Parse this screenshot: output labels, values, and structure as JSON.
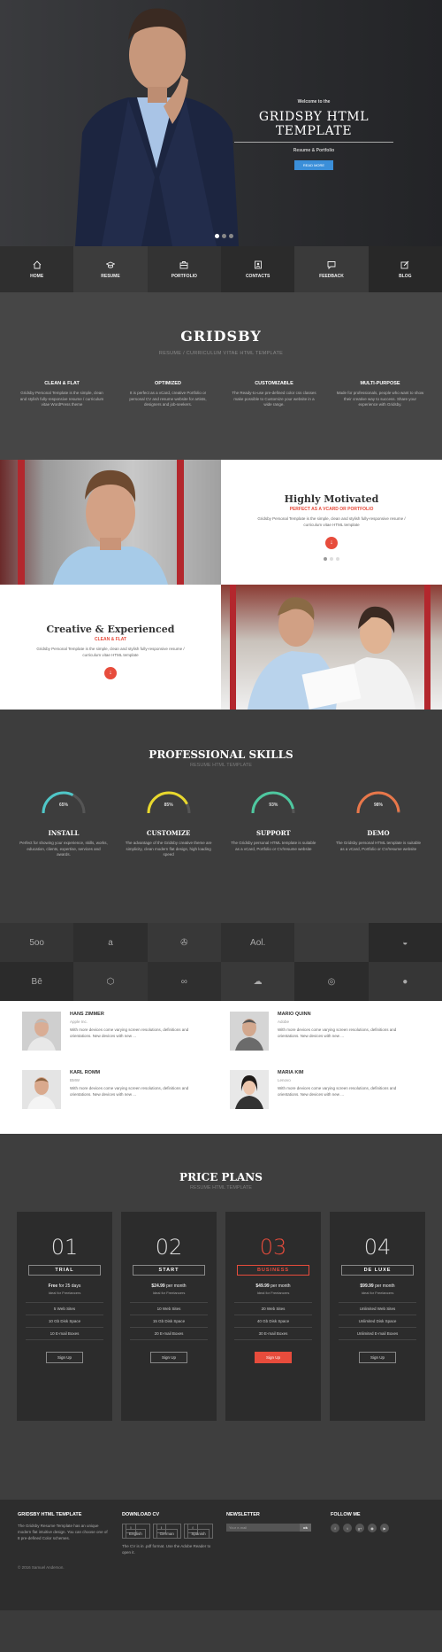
{
  "hero": {
    "welcome": "Welcome to the",
    "title": "GRIDSBY HTML TEMPLATE",
    "subtitle": "Resume & Portfolio",
    "button": "READ MORE"
  },
  "nav": [
    {
      "label": "HOME",
      "icon": "home-icon"
    },
    {
      "label": "RESUME",
      "icon": "graduation-cap-icon"
    },
    {
      "label": "PORTFOLIO",
      "icon": "briefcase-icon"
    },
    {
      "label": "CONTACTS",
      "icon": "address-card-icon"
    },
    {
      "label": "FEEDBACK",
      "icon": "chat-bubble-icon"
    },
    {
      "label": "BLOG",
      "icon": "edit-icon"
    }
  ],
  "intro": {
    "title": "GRIDSBY",
    "tagline": "RESUME / CURRICULUM VITAE HTML TEMPLATE",
    "features": [
      {
        "title": "CLEAN & FLAT",
        "text": "Gridsby Personal Template is the simple, clean and stylish fully-responsive resume / curriculum vitae WordPress theme"
      },
      {
        "title": "OPTIMIZED",
        "text": "It is perfect as a vCard, creative Portfolio or personal CV and resume website for artists, designers and job-seekers."
      },
      {
        "title": "CUSTOMIZABLE",
        "text": "The Ready-to-use pre-defined color css classes make possible to Customize your website in a wide range."
      },
      {
        "title": "MULTI-PURPOSE",
        "text": "Made for professionals, people who want to show their creative way to success. Share your experience with Gridsby."
      }
    ]
  },
  "panels": [
    {
      "title": "Highly Motivated",
      "subtitle": "PERFECT AS A VCARD OR PORTFOLIO",
      "text": "Gridsby Personal Template is the simple, clean and stylish fully-responsive resume / curriculum vitae HTML template"
    },
    {
      "title": "Creative & Experienced",
      "subtitle": "CLEAN & FLAT",
      "text": "Gridsby Personal Template is the simple, clean and stylish fully-responsive resume / curriculum vitae HTML template"
    }
  ],
  "skills": {
    "title": "PROFESSIONAL SKILLS",
    "tagline": "RESUME HTML TEMPLATE",
    "items": [
      {
        "name": "INSTALL",
        "percent": "65%",
        "value": 65,
        "color": "#4fc7c8",
        "text": "Perfect for showing your experience, skills, works, education, clients, expertise, services and awards."
      },
      {
        "name": "CUSTOMIZE",
        "percent": "85%",
        "value": 85,
        "color": "#e8d82d",
        "text": "The advantage of the Gridsby creative theme are simplicity, clean modern flat design, high loading speed"
      },
      {
        "name": "SUPPORT",
        "percent": "93%",
        "value": 93,
        "color": "#4ec8a0",
        "text": "The Gridsby personal HTML template is suitable as a vCard, Portfolio or CV/resume website"
      },
      {
        "name": "DEMO",
        "percent": "98%",
        "value": 98,
        "color": "#e8774a",
        "text": "The Gridsby personal HTML template is suitable as a vCard, Portfolio or CV/resume website"
      }
    ]
  },
  "logos": [
    {
      "icon": "500px-icon",
      "glyph": "5oo",
      "bg": "#353535"
    },
    {
      "icon": "amazon-icon",
      "glyph": "a",
      "bg": "#2e2e2e"
    },
    {
      "icon": "android-icon",
      "glyph": "✇",
      "bg": "#383838"
    },
    {
      "icon": "aol-icon",
      "glyph": "Aol.",
      "bg": "#303030"
    },
    {
      "icon": "apple-icon",
      "glyph": "",
      "bg": "#3a3a3a"
    },
    {
      "icon": "envira-icon",
      "glyph": "◒",
      "bg": "#2a2a2a"
    },
    {
      "icon": "behance-icon",
      "glyph": "Bē",
      "bg": "#2b2b2b"
    },
    {
      "icon": "codepen-icon",
      "glyph": "⬡",
      "bg": "#363636"
    },
    {
      "icon": "creative-commons-icon",
      "glyph": "∞",
      "bg": "#2f2f2f"
    },
    {
      "icon": "cloud-icon",
      "glyph": "☁",
      "bg": "#393939"
    },
    {
      "icon": "dribbble-icon",
      "glyph": "◎",
      "bg": "#2c2c2c"
    },
    {
      "icon": "drupal-icon",
      "glyph": "●",
      "bg": "#363636"
    }
  ],
  "team": [
    {
      "name": "HANS ZIMMER",
      "role": "Apple Inc.",
      "text": "With more devices come varying screen resolutions, definitions and orientations. New devices with new ..."
    },
    {
      "name": "MARIO QUINN",
      "role": "Adobe",
      "text": "With more devices come varying screen resolutions, definitions and orientations. New devices with new ..."
    },
    {
      "name": "KARL ROMM",
      "role": "BMW",
      "text": "With more devices come varying screen resolutions, definitions and orientations. New devices with new ..."
    },
    {
      "name": "MARIA KIM",
      "role": "Lenovo",
      "text": "With more devices come varying screen resolutions, definitions and orientations. New devices with new ..."
    }
  ],
  "prices": {
    "title": "PRICE PLANS",
    "tagline": "RESUME HTML TEMPLATE",
    "plans": [
      {
        "num": "01",
        "name": "TRIAL",
        "price": "Free",
        "period": " for 25 days",
        "for": "Ideal for Freelancers",
        "features": [
          "5 Web Sites",
          "10 Gb Disk Space",
          "10 E-mail Boxes"
        ],
        "button": "Sign Up",
        "hot": false
      },
      {
        "num": "02",
        "name": "START",
        "price": "$24.99",
        "period": " per month",
        "for": "Ideal for Freelancers",
        "features": [
          "10 Web Sites",
          "15 Gb Disk Space",
          "20 E-mail Boxes"
        ],
        "button": "Sign Up",
        "hot": false
      },
      {
        "num": "03",
        "name": "BUSINESS",
        "price": "$49.99",
        "period": " per month",
        "for": "Ideal for Freelancers",
        "features": [
          "20 Web Sites",
          "40 Gb Disk Space",
          "30 E-mail Boxes"
        ],
        "button": "Sign Up",
        "hot": true
      },
      {
        "num": "04",
        "name": "DE LUXE",
        "price": "$99.99",
        "period": " per month",
        "for": "Ideal for Freelancers",
        "features": [
          "Unlimited Web Sites",
          "Unlimited Disk Space",
          "Unlimited E-mail Boxes"
        ],
        "button": "Sign Up",
        "hot": false
      }
    ]
  },
  "footer": {
    "about_title": "GRIDSBY HTML TEMPLATE",
    "about_text": "The Gridsby Resume Template has an unique modern flat intuitive design. You can choose one of 8 pre-defined Color schemes.",
    "cv_title": "DOWNLOAD CV",
    "langs": [
      "English",
      "German",
      "Spanish"
    ],
    "cv_text": "The CV is in .pdf format. Use the Adobe Reader to open it.",
    "news_title": "NEWSLETTER",
    "news_placeholder": "Your e-mail",
    "news_button": "ok",
    "follow_title": "FOLLOW ME",
    "social": [
      {
        "icon": "facebook-icon",
        "glyph": "f"
      },
      {
        "icon": "twitter-icon",
        "glyph": "t"
      },
      {
        "icon": "google-plus-icon",
        "glyph": "g+"
      },
      {
        "icon": "instagram-icon",
        "glyph": "◉"
      },
      {
        "icon": "youtube-icon",
        "glyph": "▶"
      }
    ],
    "copyright": "© 2016 Samuel Anderson."
  }
}
